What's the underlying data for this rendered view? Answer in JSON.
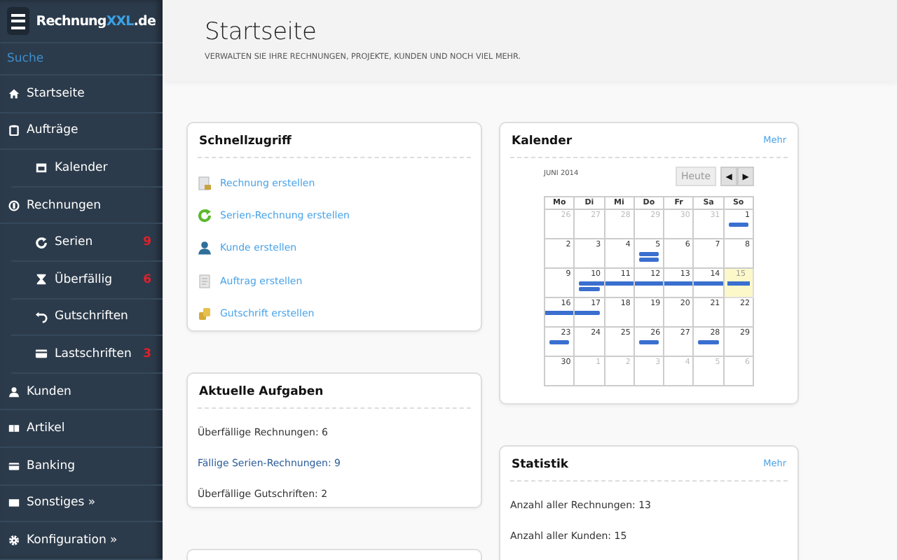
{
  "brand": {
    "name": "Rechnung",
    "accent": "XXL",
    "suffix": ".de"
  },
  "search": {
    "placeholder": "Suche"
  },
  "sidebar": {
    "items": [
      {
        "label": "Startseite",
        "kind": "home"
      },
      {
        "label": "Aufträge",
        "kind": "clipboard",
        "children": [
          {
            "label": "Kalender",
            "kind": "calendar"
          }
        ]
      },
      {
        "label": "Rechnungen",
        "kind": "coin",
        "children": [
          {
            "label": "Serien",
            "kind": "refresh",
            "badge": "9"
          },
          {
            "label": "Überfällig",
            "kind": "hourglass",
            "badge": "6"
          },
          {
            "label": "Gutschriften",
            "kind": "undo"
          },
          {
            "label": "Lastschriften",
            "kind": "card",
            "badge": "3"
          }
        ]
      },
      {
        "label": "Kunden",
        "kind": "user"
      },
      {
        "label": "Artikel",
        "kind": "book"
      },
      {
        "label": "Banking",
        "kind": "card"
      },
      {
        "label": "Sonstiges »",
        "kind": "box"
      },
      {
        "label": "Konfiguration »",
        "kind": "gear"
      }
    ]
  },
  "header": {
    "title": "Startseite",
    "subtitle": "VERWALTEN SIE IHRE RECHNUNGEN, PROJEKTE, KUNDEN UND NOCH VIEL MEHR."
  },
  "quick_access": {
    "title": "Schnellzugriff",
    "links": [
      {
        "label": "Rechnung erstellen",
        "kind": "invoice"
      },
      {
        "label": "Serien-Rechnung erstellen",
        "kind": "refresh"
      },
      {
        "label": "Kunde erstellen",
        "kind": "user"
      },
      {
        "label": "Auftrag erstellen",
        "kind": "document"
      },
      {
        "label": "Gutschrift erstellen",
        "kind": "coins"
      }
    ]
  },
  "tasks": {
    "title": "Aktuelle Aufgaben",
    "lines": [
      "Überfällige Rechnungen: 6",
      "Fällige Serien-Rechnungen: 9",
      "Überfällige Gutschriften: 2"
    ]
  },
  "calendar": {
    "title": "Kalender",
    "more": "Mehr",
    "month": "JUNI 2014",
    "today_button": "Heute",
    "prev": "◀",
    "next": "▶",
    "weekdays": [
      "Mo",
      "Di",
      "Mi",
      "Do",
      "Fr",
      "Sa",
      "So"
    ],
    "weeks": [
      [
        {
          "day": "26",
          "muted": true,
          "today": false
        },
        {
          "day": "27",
          "muted": true,
          "today": false
        },
        {
          "day": "28",
          "muted": true,
          "today": false
        },
        {
          "day": "29",
          "muted": true,
          "today": false
        },
        {
          "day": "30",
          "muted": true,
          "today": false
        },
        {
          "day": "31",
          "muted": true,
          "today": false
        },
        {
          "day": "1",
          "muted": false,
          "today": false,
          "events": [
            {
              "kind": "single"
            }
          ]
        }
      ],
      [
        {
          "day": "2",
          "muted": false,
          "today": false
        },
        {
          "day": "3",
          "muted": false,
          "today": false
        },
        {
          "day": "4",
          "muted": false,
          "today": false
        },
        {
          "day": "5",
          "muted": false,
          "today": false,
          "events": [
            {
              "kind": "single"
            },
            {
              "kind": "single"
            }
          ]
        },
        {
          "day": "6",
          "muted": false,
          "today": false
        },
        {
          "day": "7",
          "muted": false,
          "today": false
        },
        {
          "day": "8",
          "muted": false,
          "today": false
        }
      ],
      [
        {
          "day": "9",
          "muted": false,
          "today": false
        },
        {
          "day": "10",
          "muted": false,
          "today": false,
          "events": [
            {
              "kind": "start"
            },
            {
              "kind": "single"
            }
          ]
        },
        {
          "day": "11",
          "muted": false,
          "today": false,
          "events": [
            {
              "kind": "middle"
            }
          ]
        },
        {
          "day": "12",
          "muted": false,
          "today": false,
          "events": [
            {
              "kind": "middle"
            }
          ]
        },
        {
          "day": "13",
          "muted": false,
          "today": false,
          "events": [
            {
              "kind": "middle"
            }
          ]
        },
        {
          "day": "14",
          "muted": false,
          "today": false,
          "events": [
            {
              "kind": "middle"
            }
          ]
        },
        {
          "day": "15",
          "muted": false,
          "today": true,
          "events": [
            {
              "kind": "middle"
            }
          ]
        }
      ],
      [
        {
          "day": "16",
          "muted": false,
          "today": false,
          "events": [
            {
              "kind": "middle"
            }
          ]
        },
        {
          "day": "17",
          "muted": false,
          "today": false,
          "events": [
            {
              "kind": "end"
            }
          ]
        },
        {
          "day": "18",
          "muted": false,
          "today": false
        },
        {
          "day": "19",
          "muted": false,
          "today": false
        },
        {
          "day": "20",
          "muted": false,
          "today": false
        },
        {
          "day": "21",
          "muted": false,
          "today": false
        },
        {
          "day": "22",
          "muted": false,
          "today": false
        }
      ],
      [
        {
          "day": "23",
          "muted": false,
          "today": false,
          "events": [
            {
              "kind": "single"
            }
          ]
        },
        {
          "day": "24",
          "muted": false,
          "today": false
        },
        {
          "day": "25",
          "muted": false,
          "today": false
        },
        {
          "day": "26",
          "muted": false,
          "today": false,
          "events": [
            {
              "kind": "single"
            }
          ]
        },
        {
          "day": "27",
          "muted": false,
          "today": false
        },
        {
          "day": "28",
          "muted": false,
          "today": false,
          "events": [
            {
              "kind": "single"
            }
          ]
        },
        {
          "day": "29",
          "muted": false,
          "today": false
        }
      ],
      [
        {
          "day": "30",
          "muted": false,
          "today": false
        },
        {
          "day": "1",
          "muted": true,
          "today": false
        },
        {
          "day": "2",
          "muted": true,
          "today": false
        },
        {
          "day": "3",
          "muted": true,
          "today": false
        },
        {
          "day": "4",
          "muted": true,
          "today": false
        },
        {
          "day": "5",
          "muted": true,
          "today": false
        },
        {
          "day": "6",
          "muted": true,
          "today": false
        }
      ]
    ]
  },
  "statistics": {
    "title": "Statistik",
    "more": "Mehr",
    "lines": [
      "Anzahl aller Rechnungen: 13",
      "Anzahl aller Kunden: 15"
    ]
  }
}
